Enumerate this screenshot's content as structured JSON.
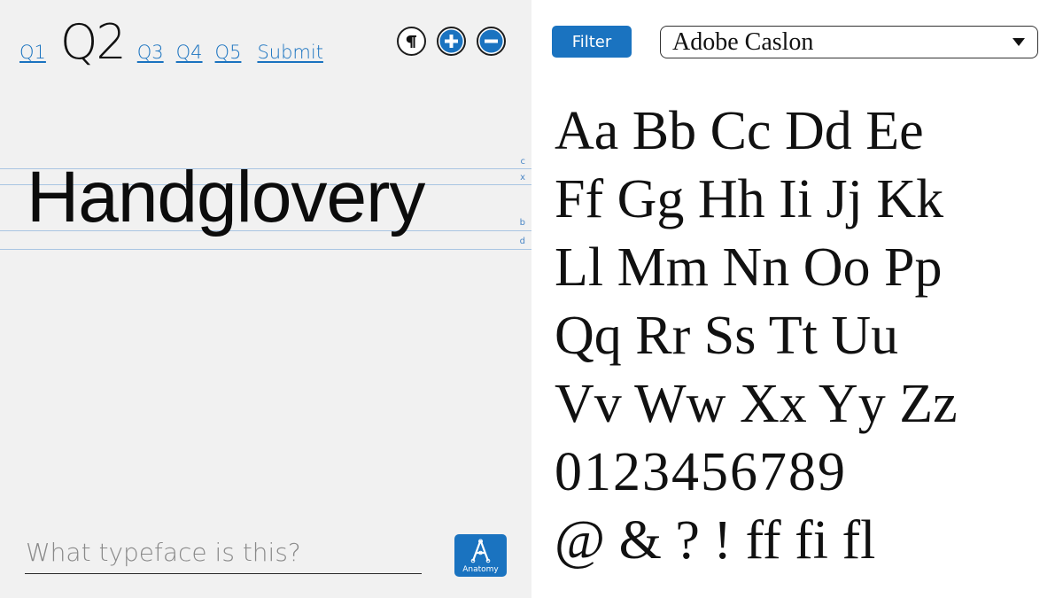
{
  "nav": {
    "questions": [
      "Q1",
      "Q2",
      "Q3",
      "Q4",
      "Q5"
    ],
    "current": "Q2",
    "submit_label": "Submit"
  },
  "tools": {
    "paragraph_icon": "pilcrow-icon",
    "zoom_in_icon": "plus-icon",
    "zoom_out_icon": "minus-icon"
  },
  "specimen": {
    "word": "Handglovery",
    "guides": [
      "c",
      "x",
      "b",
      "d"
    ]
  },
  "answer": {
    "placeholder": "What typeface is this?",
    "value": ""
  },
  "anatomy": {
    "label": "Anatomy",
    "icon": "letter-a-anatomy-icon"
  },
  "filter": {
    "label": "Filter"
  },
  "font_select": {
    "selected": "Adobe Caslon",
    "icon": "caret-down-icon"
  },
  "glyphs": {
    "rows": [
      "Aa Bb Cc Dd Ee",
      "Ff Gg Hh Ii Jj Kk",
      "Ll Mm Nn Oo Pp",
      "Qq Rr Ss Tt Uu",
      "Vv Ww Xx Yy Zz",
      "0123456789",
      "@ & ? ! ff fi fl"
    ]
  },
  "colors": {
    "accent": "#1a73c0",
    "left_panel_bg": "#f1f1f1",
    "guide_line": "#a9c5e2",
    "text": "#111111"
  }
}
